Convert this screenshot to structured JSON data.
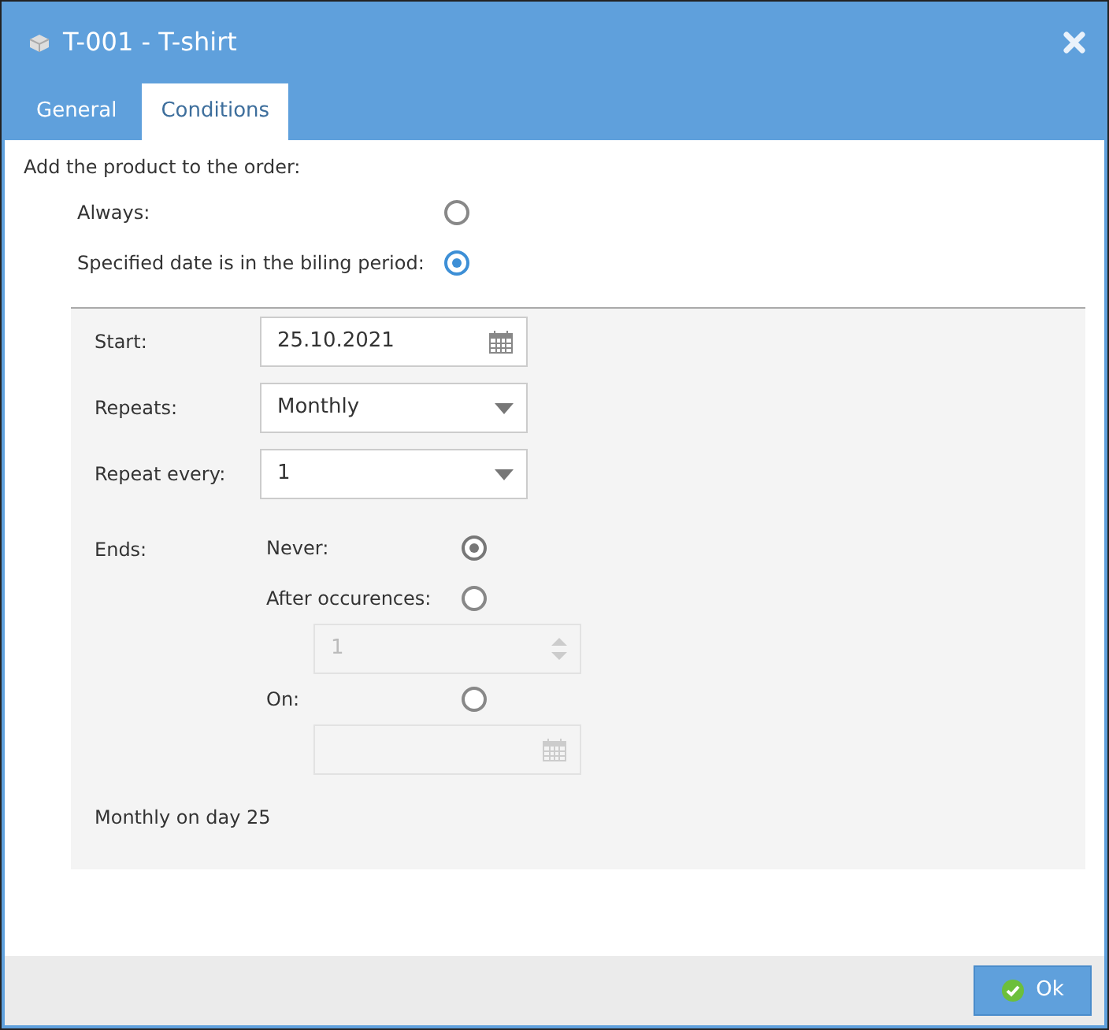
{
  "dialog": {
    "title": "T-001 - T-shirt"
  },
  "tabs": [
    {
      "label": "General",
      "selected": false
    },
    {
      "label": "Conditions",
      "selected": true
    }
  ],
  "intro": "Add the product to the order:",
  "options": [
    {
      "label": "Always:",
      "selected": false
    },
    {
      "label": "Specified date is in the biling period:",
      "selected": true
    }
  ],
  "schedule": {
    "fields": [
      {
        "label": "Start:",
        "value": "25.10.2021",
        "kind": "date"
      },
      {
        "label": "Repeats:",
        "value": "Monthly",
        "kind": "select"
      },
      {
        "label": "Repeat every:",
        "value": "1",
        "kind": "select"
      }
    ],
    "ends_label": "Ends:",
    "ends": [
      {
        "label": "Never:",
        "selected": true
      },
      {
        "label": "After occurences:",
        "selected": false,
        "field": {
          "kind": "number",
          "value": "1",
          "disabled": true
        }
      },
      {
        "label": "On:",
        "selected": false,
        "field": {
          "kind": "date",
          "disabled": true
        }
      }
    ],
    "summary": "Monthly on day 25"
  },
  "buttons": [
    {
      "label": "Ok"
    }
  ]
}
